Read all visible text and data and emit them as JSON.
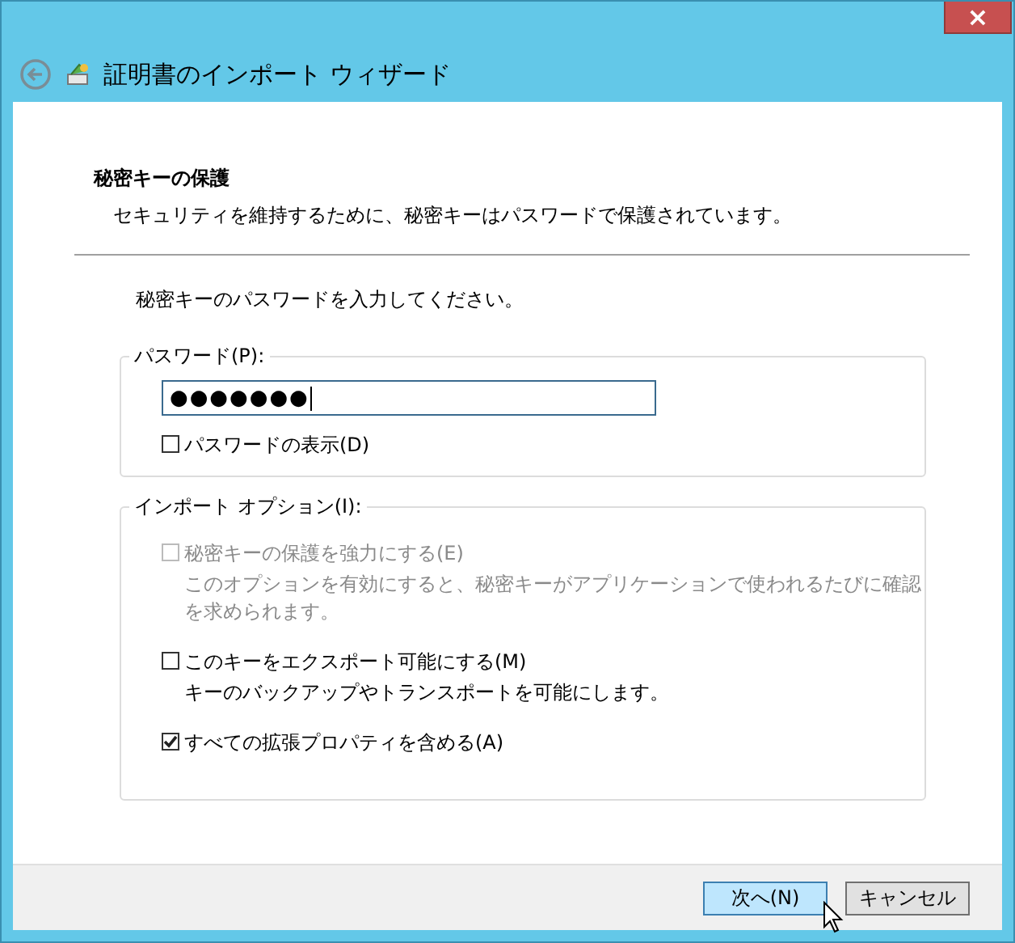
{
  "window": {
    "close": "×"
  },
  "header": {
    "title": "証明書のインポート ウィザード"
  },
  "section": {
    "title": "秘密キーの保護",
    "subtitle": "セキュリティを維持するために、秘密キーはパスワードで保護されています。"
  },
  "instruction": "秘密キーのパスワードを入力してください。",
  "password_group": {
    "legend": "パスワード(P):",
    "value": "●●●●●●●",
    "show_password": {
      "label": "パスワードの表示(D)",
      "checked": false,
      "disabled": false
    }
  },
  "options_group": {
    "legend": "インポート オプション(I):",
    "options": [
      {
        "label": "秘密キーの保護を強力にする(E)",
        "description": "このオプションを有効にすると、秘密キーがアプリケーションで使われるたびに確認を求められます。",
        "checked": false,
        "disabled": true
      },
      {
        "label": "このキーをエクスポート可能にする(M)",
        "description": "キーのバックアップやトランスポートを可能にします。",
        "checked": false,
        "disabled": false
      },
      {
        "label": "すべての拡張プロパティを含める(A)",
        "checked": true,
        "disabled": false
      }
    ]
  },
  "buttons": [
    {
      "label": "次へ(N)",
      "selected": true
    },
    {
      "label": "キャンセル",
      "selected": false
    }
  ]
}
